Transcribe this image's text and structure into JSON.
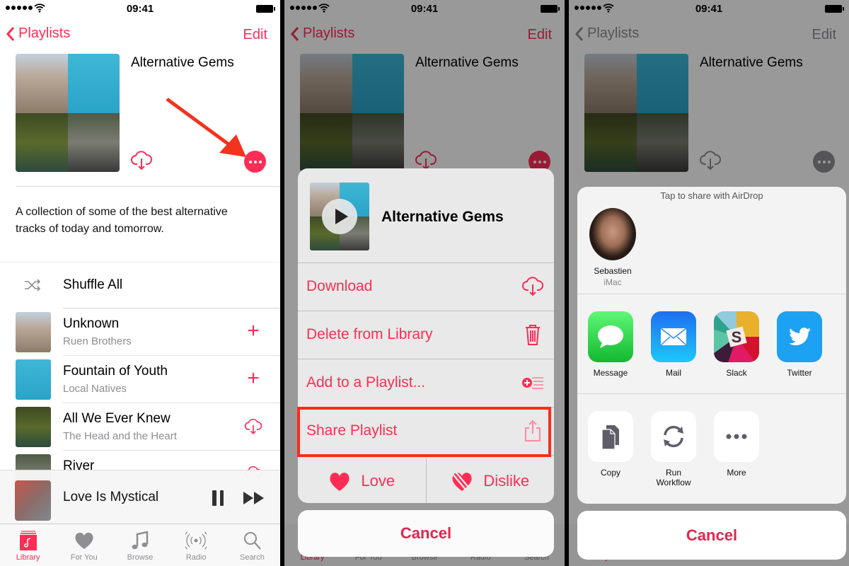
{
  "status": {
    "time": "09:41"
  },
  "nav": {
    "back_label": "Playlists",
    "edit_label": "Edit"
  },
  "playlist": {
    "title": "Alternative Gems",
    "description": "A collection of some of the best alternative tracks of today and tomorrow."
  },
  "shuffle_label": "Shuffle All",
  "tracks": [
    {
      "name": "Unknown",
      "artist": "Ruen Brothers",
      "action": "add"
    },
    {
      "name": "Fountain of Youth",
      "artist": "Local Natives",
      "action": "add"
    },
    {
      "name": "All We Ever Knew",
      "artist": "The Head and the Heart",
      "action": "download"
    },
    {
      "name": "River",
      "artist": "",
      "action": "download"
    }
  ],
  "now_playing": {
    "title": "Love Is Mystical"
  },
  "tabs": [
    {
      "label": "Library",
      "icon": "library-icon",
      "active": true
    },
    {
      "label": "For You",
      "icon": "heart-icon",
      "active": false
    },
    {
      "label": "Browse",
      "icon": "music-note-icon",
      "active": false
    },
    {
      "label": "Radio",
      "icon": "radio-icon",
      "active": false
    },
    {
      "label": "Search",
      "icon": "search-icon",
      "active": false
    }
  ],
  "action_sheet": {
    "title": "Alternative Gems",
    "items": [
      {
        "label": "Download",
        "icon": "cloud-download-icon"
      },
      {
        "label": "Delete from Library",
        "icon": "trash-icon"
      },
      {
        "label": "Add to a Playlist...",
        "icon": "add-to-playlist-icon"
      },
      {
        "label": "Share Playlist",
        "icon": "share-icon",
        "highlighted": true
      }
    ],
    "love_label": "Love",
    "dislike_label": "Dislike",
    "cancel_label": "Cancel"
  },
  "share_sheet": {
    "airdrop_title": "Tap to share with AirDrop",
    "person": {
      "name": "Sebastien",
      "device": "iMac"
    },
    "apps": [
      {
        "label": "Message",
        "icon": "message-icon"
      },
      {
        "label": "Mail",
        "icon": "mail-icon"
      },
      {
        "label": "Slack",
        "icon": "slack-icon"
      },
      {
        "label": "Twitter",
        "icon": "twitter-icon"
      }
    ],
    "actions": [
      {
        "label": "Copy",
        "icon": "copy-icon"
      },
      {
        "label": "Run Workflow",
        "icon": "workflow-icon"
      },
      {
        "label": "More",
        "icon": "more-icon"
      }
    ],
    "cancel_label": "Cancel"
  },
  "colors": {
    "accent": "#ff2d55",
    "highlight_box": "#ff2a1a"
  }
}
